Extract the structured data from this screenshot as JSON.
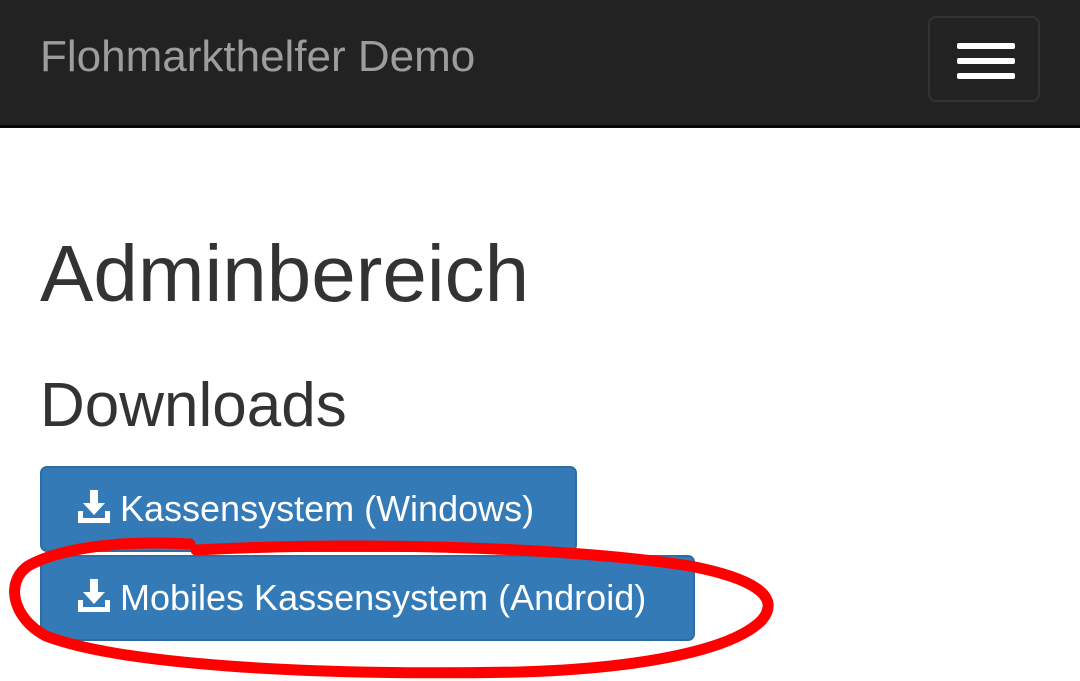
{
  "navbar": {
    "brand": "Flohmarkthelfer Demo",
    "toggle_icon": "hamburger-menu-icon",
    "background_color": "#222222",
    "brand_color": "#9d9d9d"
  },
  "main": {
    "title": "Adminbereich",
    "downloads": {
      "heading": "Downloads",
      "buttons": [
        {
          "label": "Kassensystem (Windows)",
          "icon": "download-icon"
        },
        {
          "label": "Mobiles Kassensystem (Android)",
          "icon": "download-icon"
        }
      ]
    }
  },
  "colors": {
    "button_primary": "#337ab7",
    "annotation_stroke": "#ff0000"
  },
  "annotation": {
    "type": "freehand-circle",
    "highlights": "Mobiles Kassensystem (Android)"
  }
}
